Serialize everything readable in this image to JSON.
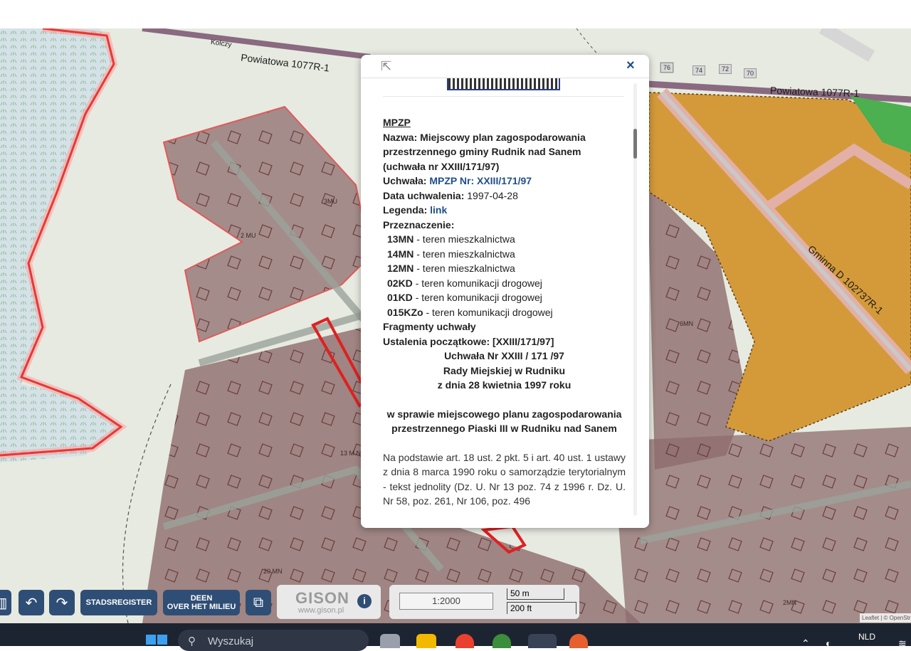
{
  "map": {
    "road_labels": {
      "top_left": "Powiatowa 1077R-1",
      "top_left_small": "Kolczy",
      "top_right": "Powiatowa 1077R-1",
      "diagonal": "Gminna D 102737R-1"
    },
    "house_numbers": [
      "76",
      "74",
      "72",
      "70"
    ],
    "plot_labels": [
      "3MU",
      "2 MU",
      "13 M.N",
      "20 MN",
      "2MN",
      "6MN"
    ]
  },
  "popup": {
    "close_label": "×",
    "move_icon": "move-cursor-icon",
    "heading": "MPZP",
    "nazwa_label": "Nazwa:",
    "nazwa_value": "Miejscowy plan zagospodarowania przestrzennego gminy Rudnik nad Sanem (uchwała nr XXIII/171/97)",
    "uchwala_label": "Uchwała:",
    "uchwala_link": "MPZP Nr: XXIII/171/97",
    "data_label": "Data uchwalenia:",
    "data_value": "1997-04-28",
    "legenda_label": "Legenda:",
    "legenda_link": "link",
    "przeznaczenie_label": "Przeznaczenie:",
    "przeznaczenie": [
      {
        "code": "13MN",
        "desc": "- teren mieszkalnictwa"
      },
      {
        "code": "14MN",
        "desc": "- teren mieszkalnictwa"
      },
      {
        "code": "12MN",
        "desc": "- teren mieszkalnictwa"
      },
      {
        "code": "02KD",
        "desc": "- teren komunikacji drogowej"
      },
      {
        "code": "01KD",
        "desc": "- teren komunikacji drogowej"
      },
      {
        "code": "015KZo",
        "desc": "- teren komunikacji drogowej"
      }
    ],
    "fragmenty": "Fragmenty uchwały",
    "ustalenia_label": "Ustalenia początkowe: [XXIII/171/97]",
    "center_1": "Uchwała Nr XXIII / 171 /97",
    "center_2": "Rady Miejskiej w Rudniku",
    "center_3": "z dnia 28 kwietnia 1997 roku",
    "center_4": "w sprawie miejscowego planu zagospodarowania przestrzennego Piaski III w Rudniku nad Sanem",
    "body_text": "Na podstawie art. 18 ust. 2 pkt. 5 i art. 40 ust. 1 ustawy z dnia 8 marca 1990 roku o samorządzie terytorialnym - tekst jednolity (Dz. U. Nr 13 poz. 74 z 1996 r. Dz. U. Nr 58, poz. 261, Nr 106, poz. 496"
  },
  "toolbar": {
    "stadsregister": "STADSREGISTER",
    "deen_line1": "DEEN",
    "deen_line2": "OVER HET MILIEU",
    "gison_name": "GISON",
    "gison_url": "www.gison.pl",
    "scale_ratio": "1:2000",
    "scale_m": "50 m",
    "scale_ft": "200 ft",
    "attribution": "Leaflet | © OpenStreetMap"
  },
  "taskbar": {
    "search_placeholder": "Wyszukaj",
    "language": "NLD"
  },
  "colors": {
    "residential_zone": "#8b6b6b",
    "commercial_zone": "#d49a3a",
    "green_zone": "#4caf50",
    "red_outline": "#e53935",
    "button_blue": "#2f4e75"
  }
}
